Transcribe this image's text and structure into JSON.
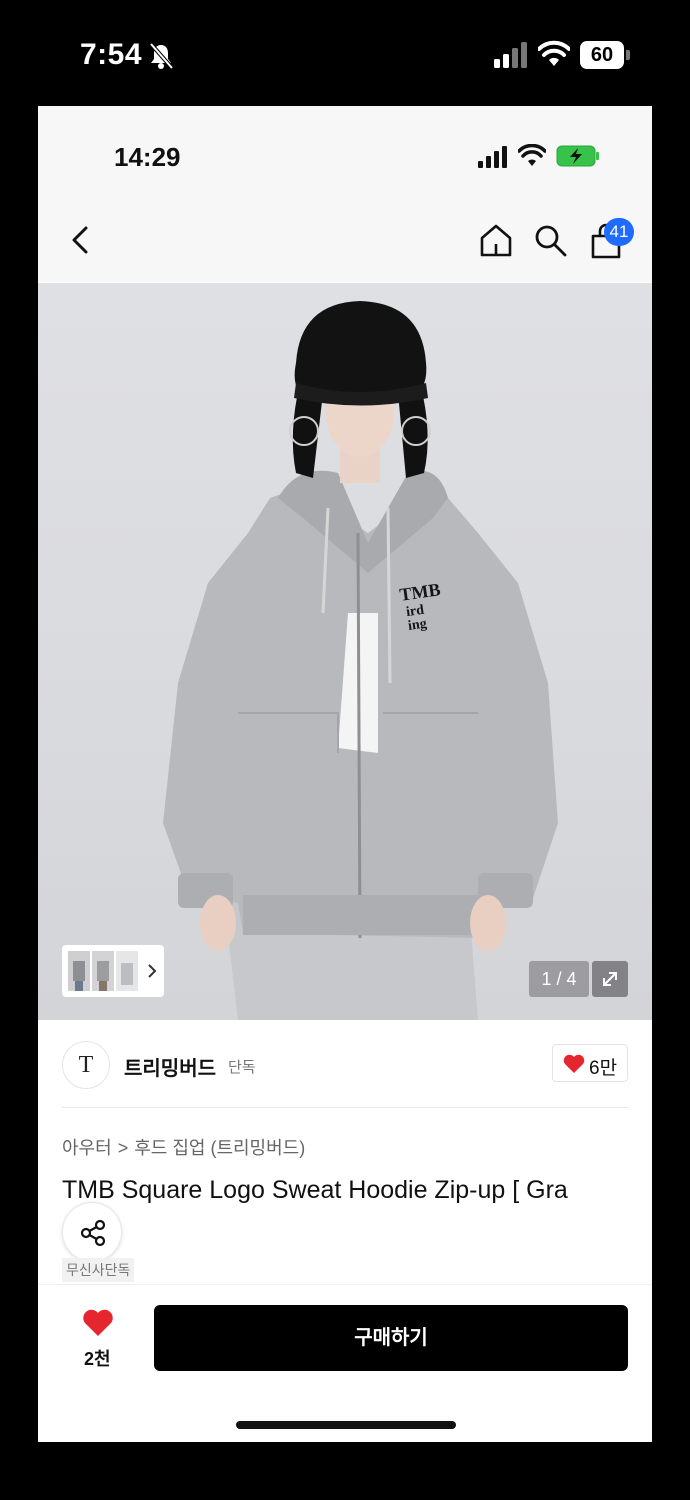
{
  "os_status": {
    "time": "7:54",
    "battery": "60",
    "icons": [
      "bell-slash-icon",
      "signal-icon",
      "wifi-icon",
      "battery-icon"
    ]
  },
  "app_status": {
    "time": "14:29",
    "icons": [
      "signal-icon",
      "wifi-icon",
      "battery-charging-icon"
    ]
  },
  "nav": {
    "icons": [
      "back-arrow-icon",
      "home-icon",
      "search-icon",
      "cart-icon"
    ],
    "cart_count": "41",
    "badge_color": "#1f6bff"
  },
  "gallery": {
    "counter": "1 / 4",
    "icons": [
      "thumbnail-strip",
      "chevron-right-icon",
      "expand-icon"
    ]
  },
  "brand": {
    "logo_text": "T",
    "name": "트리밍버드",
    "tag": "단독",
    "likes": "6만"
  },
  "breadcrumb": {
    "level1": "아우터",
    "separator": ">",
    "level2": "후드 집업 (트리밍버드)"
  },
  "product": {
    "title": "TMB Square Logo Sweat Hoodie Zip-up [ Gra",
    "exclusive_label": "무신사단독"
  },
  "bottom_bar": {
    "wish_count": "2천",
    "buy_label": "구매하기",
    "accent_color": "#e5262f"
  }
}
